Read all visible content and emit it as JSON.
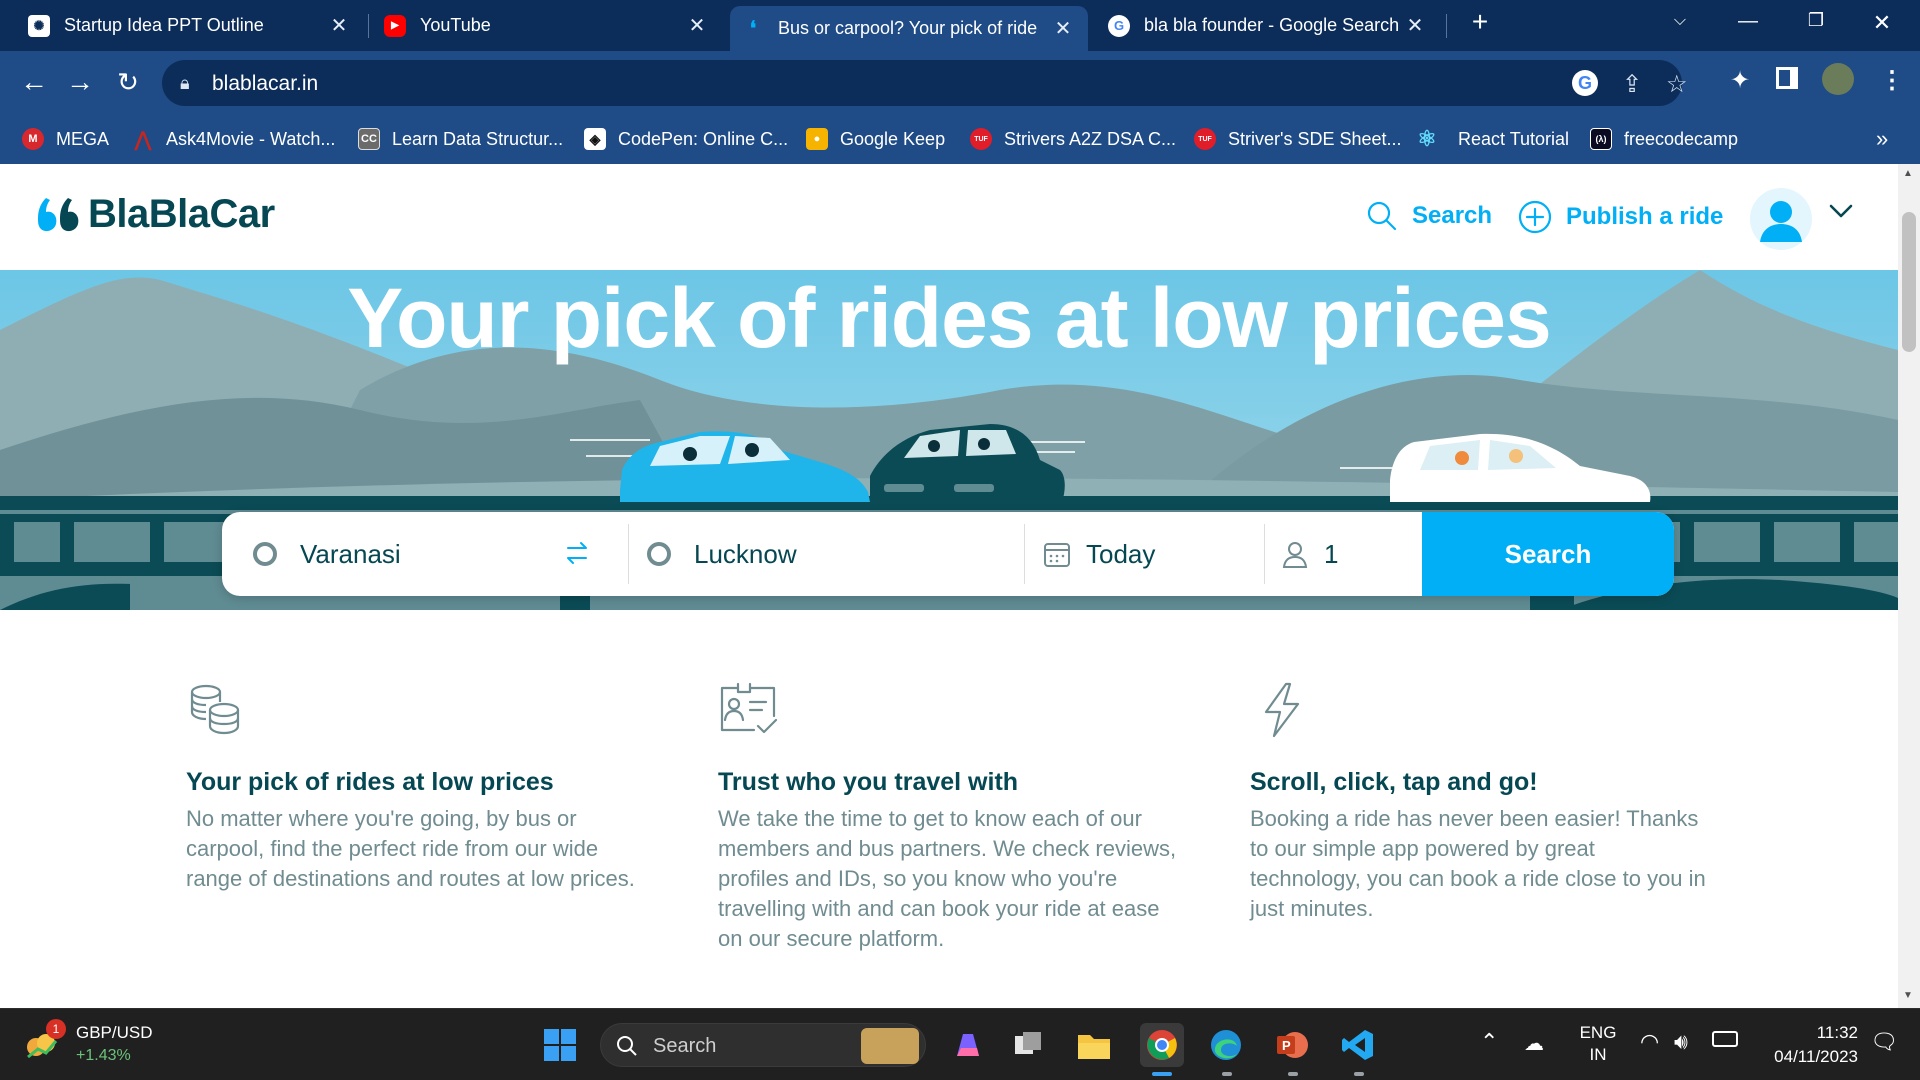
{
  "browser": {
    "tabs": [
      {
        "label": "Startup Idea PPT Outline",
        "icon": "chatgpt-icon",
        "active": false
      },
      {
        "label": "YouTube",
        "icon": "youtube-icon",
        "active": false
      },
      {
        "label": "Bus or carpool? Your pick of ride",
        "icon": "blablacar-icon",
        "active": true
      },
      {
        "label": "bla bla founder - Google Search",
        "icon": "google-icon",
        "active": false
      }
    ],
    "new_tab": "+",
    "url": "blablacar.in",
    "bookmarks": [
      {
        "label": "MEGA",
        "icon": "mega-icon",
        "color": "#d9272e",
        "glyph": "M"
      },
      {
        "label": "Ask4Movie - Watch...",
        "icon": "ask4movie-icon",
        "color": "#c7261f",
        "glyph": "A"
      },
      {
        "label": "Learn Data Structur...",
        "icon": "codingninjas-icon",
        "color": "#6b6b6b",
        "glyph": "CC"
      },
      {
        "label": "CodePen: Online C...",
        "icon": "codepen-icon",
        "color": "#1e1e1e",
        "glyph": "◇"
      },
      {
        "label": "Google Keep",
        "icon": "google-keep-icon",
        "color": "#f6b400",
        "glyph": "▮"
      },
      {
        "label": "Strivers A2Z DSA C...",
        "icon": "tuf-icon",
        "color": "#e11d2a",
        "glyph": "TUF"
      },
      {
        "label": "Striver's SDE Sheet...",
        "icon": "tuf-icon",
        "color": "#e11d2a",
        "glyph": "TUF"
      },
      {
        "label": "React Tutorial",
        "icon": "react-icon",
        "color": "#1f4b86",
        "glyph": "⚛"
      },
      {
        "label": "freecodecamp",
        "icon": "freecodecamp-icon",
        "color": "#0a0a23",
        "glyph": "(λ)"
      }
    ],
    "bookmarks_overflow": "»"
  },
  "site": {
    "logo": "BlaBlaCar",
    "nav": {
      "search": "Search",
      "publish": "Publish a ride"
    },
    "hero_title": "Your pick of rides at low prices",
    "search_form": {
      "from": "Varanasi",
      "to": "Lucknow",
      "date": "Today",
      "passengers": "1",
      "button": "Search"
    },
    "features": [
      {
        "icon": "coins-icon",
        "title": "Your pick of rides at low prices",
        "body": "No matter where you're going, by bus or carpool, find the perfect ride from our wide range of destinations and routes at low prices."
      },
      {
        "icon": "id-check-icon",
        "title": "Trust who you travel with",
        "body": "We take the time to get to know each of our members and bus partners. We check reviews, profiles and IDs, so you know who you're travelling with and can book your ride at ease on our secure platform."
      },
      {
        "icon": "lightning-icon",
        "title": "Scroll, click, tap and go!",
        "body": "Booking a ride has never been easier! Thanks to our simple app powered by great technology, you can book a ride close to you in just minutes."
      }
    ],
    "colors": {
      "brand": "#054752",
      "accent": "#00aff5"
    }
  },
  "taskbar": {
    "widget": {
      "badge": "1",
      "title": "GBP/USD",
      "change": "+1.43%"
    },
    "search_placeholder": "Search",
    "tray": {
      "lang": "ENG",
      "region": "IN",
      "time": "11:32",
      "date": "04/11/2023"
    }
  }
}
